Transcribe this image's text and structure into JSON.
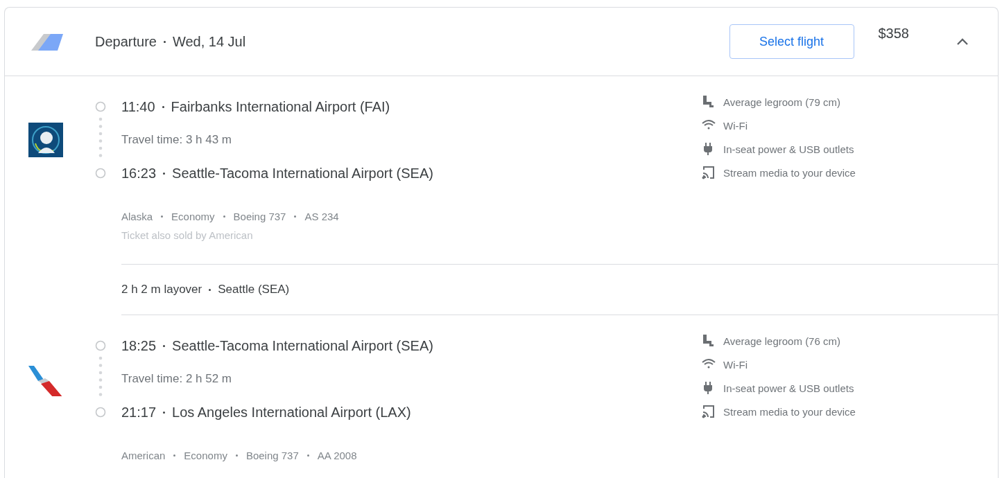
{
  "header": {
    "title": "Departure",
    "date": "Wed, 14 Jul",
    "button": "Select flight",
    "price": "$358",
    "expanded": true
  },
  "items": [
    {
      "kind": "leg",
      "departure": {
        "time": "11:40",
        "airport": "Fairbanks International Airport (FAI)"
      },
      "travel_time": "Travel time: 3 h 43 m",
      "arrival": {
        "time": "16:23",
        "airport": "Seattle-Tacoma International Airport (SEA)"
      },
      "details": [
        "Alaska",
        "Economy",
        "Boeing 737",
        "AS 234"
      ],
      "note": "Ticket also sold by American",
      "amenities": [
        {
          "kind": "legroom",
          "text": "Average legroom (79 cm)"
        },
        {
          "kind": "wifi",
          "text": "Wi-Fi"
        },
        {
          "kind": "power",
          "text": "In-seat power & USB outlets"
        },
        {
          "kind": "stream",
          "text": "Stream media to your device"
        }
      ]
    },
    {
      "kind": "layover",
      "duration": "2 h 2 m layover",
      "place": "Seattle (SEA)"
    },
    {
      "kind": "leg",
      "departure": {
        "time": "18:25",
        "airport": "Seattle-Tacoma International Airport (SEA)"
      },
      "travel_time": "Travel time: 2 h 52 m",
      "arrival": {
        "time": "21:17",
        "airport": "Los Angeles International Airport (LAX)"
      },
      "details": [
        "American",
        "Economy",
        "Boeing 737",
        "AA 2008"
      ],
      "amenities": [
        {
          "kind": "legroom",
          "text": "Average legroom (76 cm)"
        },
        {
          "kind": "wifi",
          "text": "Wi-Fi"
        },
        {
          "kind": "power",
          "text": "In-seat power & USB outlets"
        },
        {
          "kind": "stream",
          "text": "Stream media to your device"
        }
      ]
    }
  ]
}
